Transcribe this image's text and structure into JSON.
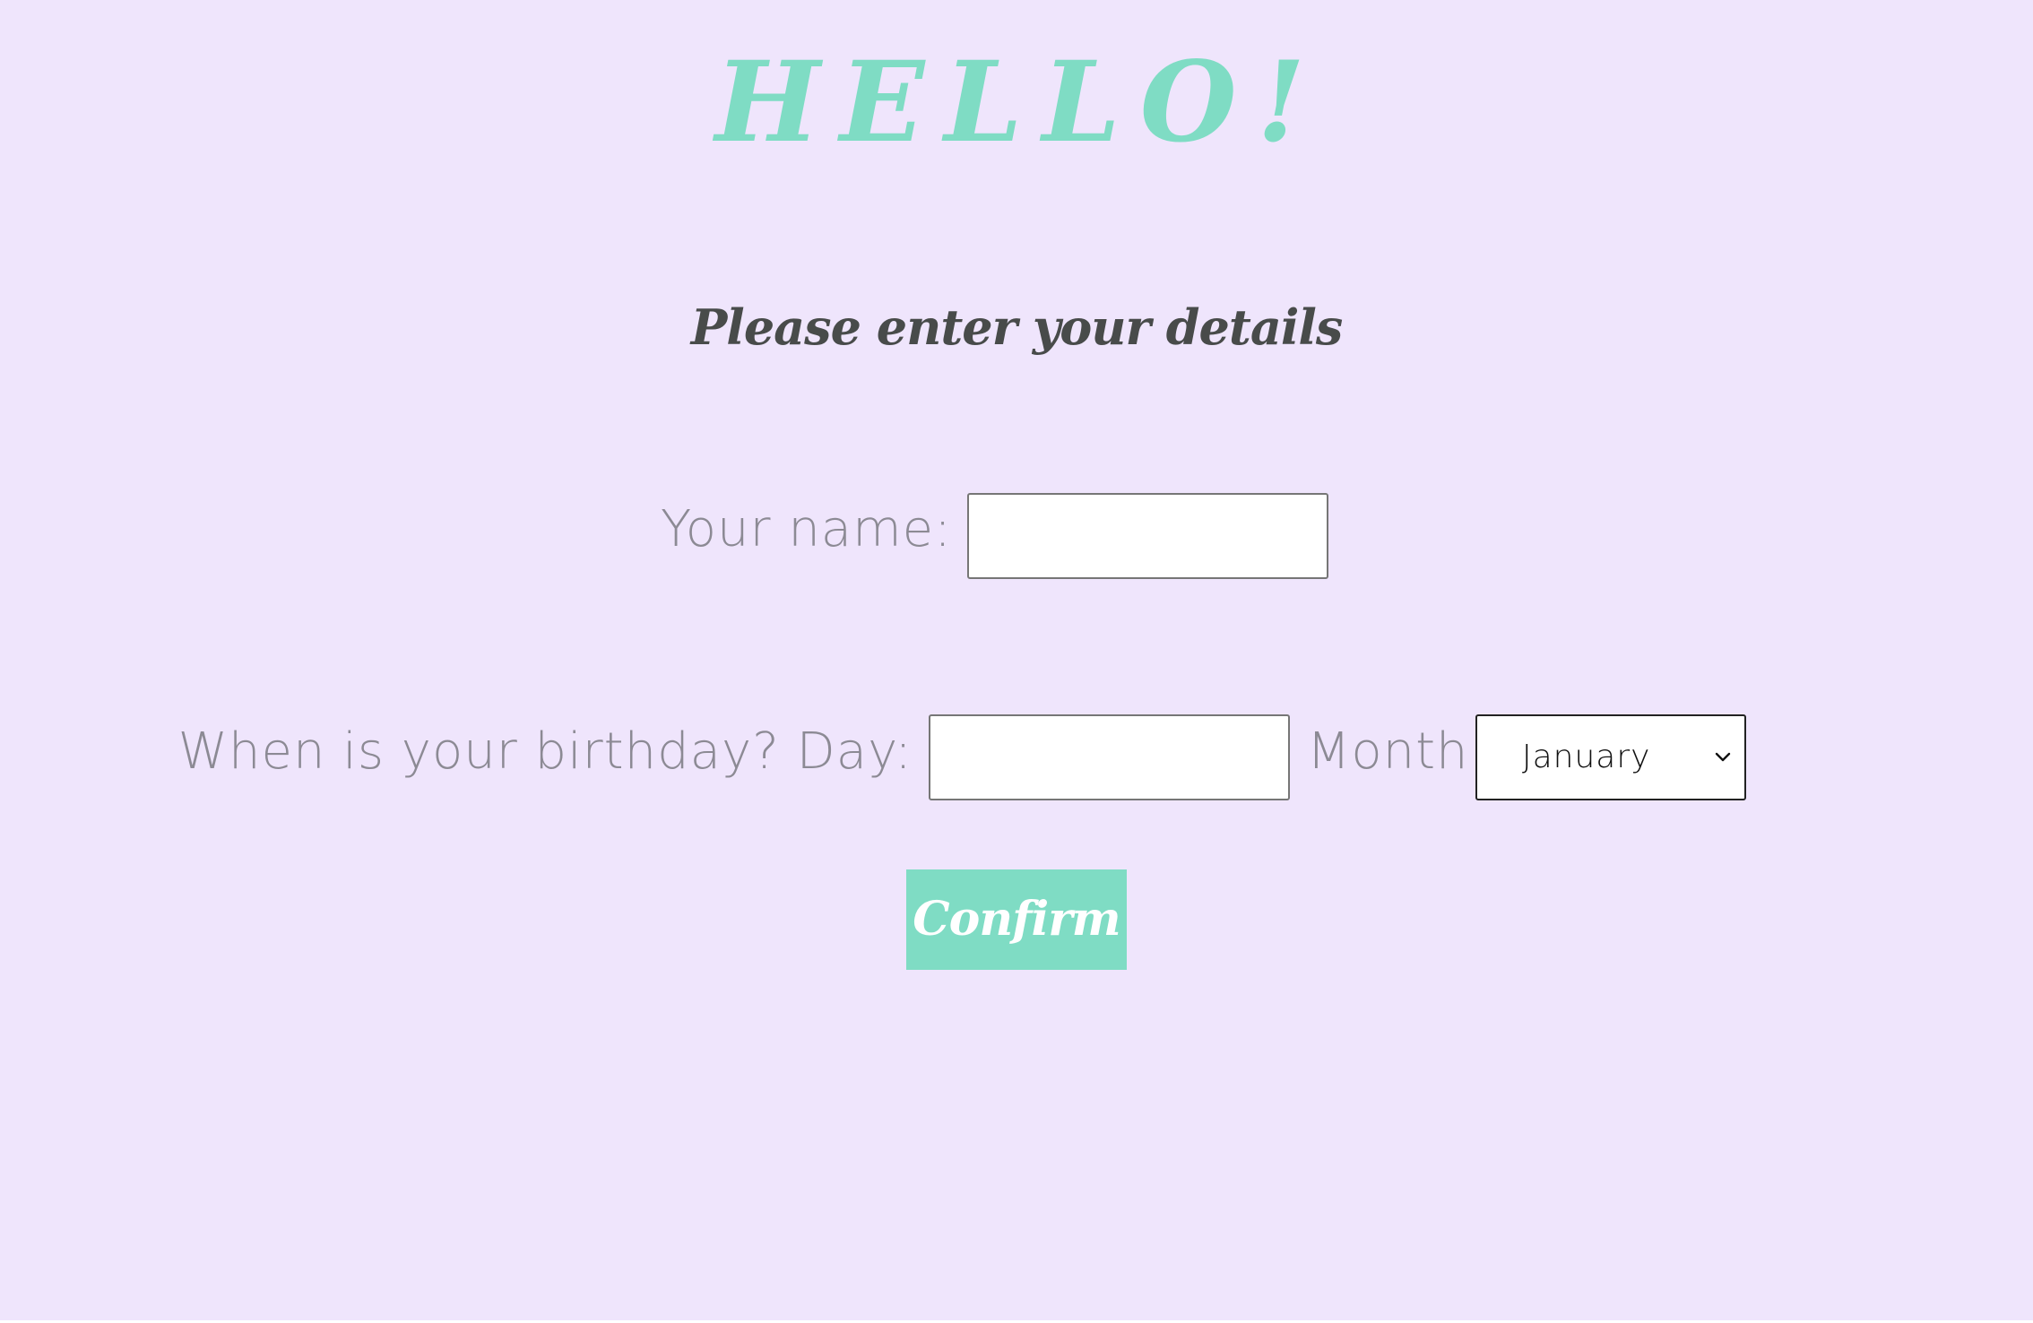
{
  "page": {
    "title": "HELLO!",
    "subtitle": "Please enter your details",
    "background_color": "#efe5fc",
    "accent_color": "#7fdcc4"
  },
  "form": {
    "name_label": "Your name:",
    "name_value": "",
    "birthday_label": "When is your birthday? Day:",
    "day_value": "",
    "month_label": "Month:",
    "month_selected": "January",
    "month_icon": "chevron-down-icon",
    "confirm_label": "Confirm"
  }
}
